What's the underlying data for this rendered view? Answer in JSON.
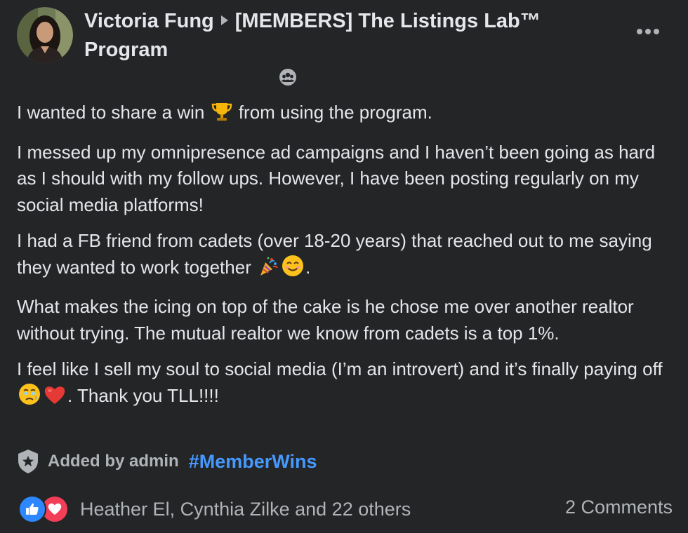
{
  "post": {
    "author": "Victoria Fung",
    "group": "[MEMBERS] The Listings Lab™ Program",
    "more_icon": "more-horizontal-icon",
    "privacy_icon": "members-group-icon",
    "paragraphs": {
      "p1": {
        "a": "I wanted to share a win ",
        "emoji": "trophy",
        "b": " from using the program."
      },
      "p2": "I messed up my omnipresence ad campaigns and I haven’t been going as hard as I should with my follow ups. However, I have been posting regularly on my social media platforms!",
      "p3": {
        "a": "I had a FB friend from cadets (over 18-20 years) that reached out to me saying they wanted to work together ",
        "emoji1": "party-popper",
        "emoji2": "smiling-face",
        "b": "."
      },
      "p4": "What makes the icing on top of the cake is he chose me over another realtor without trying. The mutual realtor we know from cadets is a top 1%.",
      "p5": {
        "a": "I feel like I sell my soul to social media (I’m an introvert) and it’s finally paying off ",
        "emoji1": "face-holding-back-tears",
        "emoji2": "red-heart",
        "b": ". Thank you TLL!!!!"
      }
    },
    "added_by": "Added by admin",
    "hashtag": "#MemberWins",
    "reactors": "Heather El, Cynthia Zilke and 22 others",
    "comments": "2 Comments"
  },
  "colors": {
    "background": "#242526",
    "text_primary": "#e4e6eb",
    "text_secondary": "#b0b3b8",
    "hashtag": "#4599ff",
    "like": "#2d88ff",
    "love": "#f33e58"
  }
}
